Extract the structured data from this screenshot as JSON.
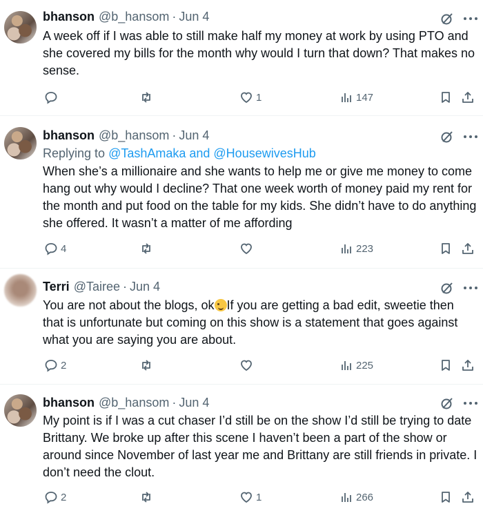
{
  "tweets": [
    {
      "name": "bhanson",
      "handle": "@b_hansom",
      "date": "Jun 4",
      "avatar": "bhanson-avatar-photo",
      "text": "A week off if I was able to still make half my money at work by using PTO and she covered my bills for the month why would I turn that down? That makes no sense.",
      "replies": "",
      "likes": "1",
      "views": "147"
    },
    {
      "name": "bhanson",
      "handle": "@b_hansom",
      "date": "Jun 4",
      "avatar": "bhanson-avatar-photo",
      "replying_prefix": "Replying to ",
      "replying_to": "@TashAmaka and @HousewivesHub",
      "text": "When she’s a millionaire and she wants to help me or give me money to come hang out why would I decline? That one week worth of money paid my rent for the month and put food on the table for my kids. She didn’t have to do anything she offered. It wasn’t a matter of me affording",
      "replies": "4",
      "likes": "",
      "views": "223"
    },
    {
      "name": "Terri",
      "handle": "@Tairee",
      "date": "Jun 4",
      "avatar": "terri-avatar-blurred",
      "text_before_emoji": "You are not about the blogs, ok",
      "emoji": "winking-face",
      "text_after_emoji": "If you are getting a bad edit, sweetie then that is unfortunate but coming on this show is a statement that goes against what you are saying you are about.",
      "replies": "2",
      "likes": "",
      "views": "225"
    },
    {
      "name": "bhanson",
      "handle": "@b_hansom",
      "date": "Jun 4",
      "avatar": "bhanson-avatar-photo",
      "text": "My point is if I was a cut chaser I’d still be on the show I’d still be trying to date Brittany. We broke up after this scene I haven’t been a part of the show or around since November of last year me and Brittany are still friends in private. I don’t need the clout.",
      "replies": "2",
      "likes": "1",
      "views": "266"
    }
  ],
  "icons": {
    "reply": "reply-icon",
    "retweet": "retweet-icon",
    "like": "heart-icon",
    "views": "views-chart-icon",
    "bookmark": "bookmark-icon",
    "share": "share-icon",
    "grok": "grok-icon",
    "more": "more-icon"
  },
  "colors": {
    "text": "#0f1419",
    "secondary": "#536471",
    "link": "#1d9bf0",
    "divider": "#eff3f4"
  }
}
